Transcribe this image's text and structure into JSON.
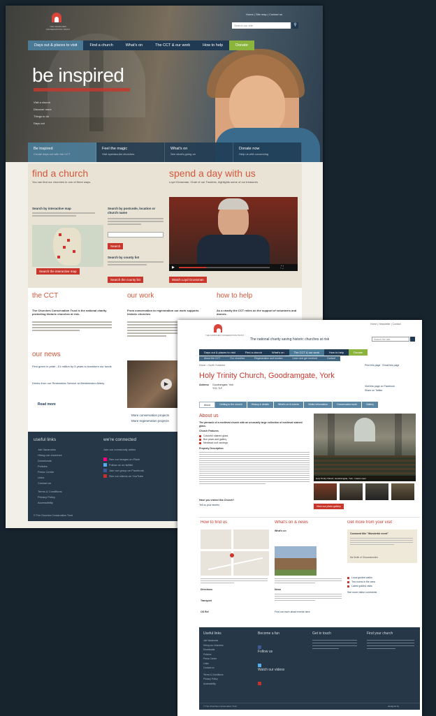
{
  "screen1": {
    "logo_text": "THE CHURCHES\nCONSERVATION TRUST",
    "top_links": [
      "Home",
      "Site map",
      "Contact us"
    ],
    "search_placeholder": "Search our site",
    "nav": [
      "Days out & places to visit",
      "Find a church",
      "What's on",
      "The CCT & our work",
      "How to help",
      "Donate"
    ],
    "hero_title": "be inspired",
    "hero_bullets": [
      "Visit a church",
      "Discover more",
      "Things to do",
      "Days out"
    ],
    "hero_tabs": [
      {
        "title": "Be inspired",
        "sub": "Create days out with the CCT"
      },
      {
        "title": "Feel the magic",
        "sub": "Visit spectacular churches"
      },
      {
        "title": "What's on",
        "sub": "See what's going on"
      },
      {
        "title": "Donate now",
        "sub": "Help us with conserving"
      }
    ],
    "find_church": {
      "title": "find a church",
      "intro": "You can find our churches in one of three ways.",
      "map_title": "Search by interactive map",
      "postcode_title": "Search by postcode, location or church name",
      "search_button": "Search",
      "county_title": "Search by county list",
      "map_button": "Search the interactive map",
      "county_button": "Search the county list"
    },
    "spend_day": {
      "title": "spend a day with us",
      "intro": "Loyd Grossman, Chair of our Trustees, highlights some of our treasures",
      "video_button": "Watch Loyd Grossman"
    },
    "cct": {
      "title": "the CCT",
      "lead": "The Churches Conservation Trust is the national charity protecting historic churches at risk."
    },
    "our_work": {
      "title": "our work",
      "lead": "From conservation to regeneration our work supports historic churches"
    },
    "how_help": {
      "title": "how to help",
      "lead": "As a charity the CCT relies on the support of volunteers and donors."
    },
    "news": {
      "title": "our news",
      "items": [
        "First green in pride - £1 million by 5 years to transform our fonds",
        "Drinks from our Restoration Service at Westminster Abbey"
      ],
      "read_more": "Read more"
    },
    "work_links": [
      "More conservation projects",
      "More regeneration projects"
    ],
    "footer": {
      "useful_links_title": "useful links",
      "useful_links": [
        "Job Vacancies",
        "Hiring our churches",
        "Downloads",
        "Policies",
        "Press Centre",
        "Links",
        "Contact us",
        "",
        "Terms & Conditions",
        "Privacy Policy",
        "Accessibility"
      ],
      "connected_title": "we're connected",
      "connected_intro": "Join our community online",
      "connected_items": [
        "See our images on Flickr",
        "Follow us on twitter",
        "Join our group on Facebook",
        "See our videos on YouTube"
      ],
      "copyright": "© The Churches Conservation Trust"
    }
  },
  "screen2": {
    "tagline": "The national charity saving historic churches at risk",
    "top_links": "Home | Newsletter | Contact",
    "search_placeholder": "Search the site",
    "nav": [
      "Days out & places to visit",
      "Find a church",
      "What's on",
      "The CCT & our work",
      "How to help",
      "Donate"
    ],
    "subnav": [
      "About the CCT",
      "Our churches",
      "Regeneration and tourism",
      "Learn and get involved",
      "Contact"
    ],
    "breadcrumb": "Home > North Yorkshire",
    "page_title": "Holy Trinity Church, Goodramgate, York",
    "address_label": "Address",
    "address_lines": [
      "Goodramgate, York",
      "YO1 7LF"
    ],
    "print_links": [
      "Print this page",
      "Email this page"
    ],
    "side_links": [
      "Visit this page on Facebook",
      "Share on Twitter"
    ],
    "tabs": [
      "About",
      "Getting to the church",
      "History & details",
      "What's on & events",
      "Visitor information",
      "Conservation work",
      "Gallery"
    ],
    "about": {
      "title": "About us",
      "lead": "The pinnacle of a medieval church with an unusually large collection of medieval stained glass.",
      "feature_title": "Church Features",
      "features": [
        "Colourful stained glass",
        "Box pews and gallery",
        "Medieval roof carvings"
      ],
      "desc_title": "Property Description",
      "visited_title": "Have you visited this Church?",
      "visited_link": "Tell us your stories",
      "photo_caption": "Holy Trinity Church, Goodramgate, York - interior view",
      "gallery_button": "View our photo gallery"
    },
    "find_us": {
      "title": "How to find us",
      "directions_title": "Directions",
      "transport_title": "Transport",
      "ref_title": "OS Ref"
    },
    "whats_on": {
      "title": "What's on & news",
      "item_title": "What's on",
      "news_title": "News",
      "more": "Find out more about events here"
    },
    "get_more": {
      "title": "Get more from your visit",
      "box_title": "Comment title \"Wonderful event\"",
      "box_sub": "Ms Smith of Gloucestershire",
      "links": [
        "Local guided walks",
        "Tea rooms in the area",
        "Latest guided visits"
      ],
      "all_link": "See more visitor comments"
    },
    "footer": {
      "useful_title": "Useful links",
      "useful_links": [
        "Job Vacancies",
        "Hiring our churches",
        "Downloads",
        "Policies",
        "Press Centre",
        "Links",
        "Contact us",
        "",
        "Terms & Conditions",
        "Privacy Policy",
        "Accessibility"
      ],
      "become_title": "Become a fan",
      "follow_title": "Follow us",
      "watch_title": "Watch our videos",
      "contact_title": "Get in touch",
      "find_title": "Find your church",
      "copyright": "© The Churches Conservation Trust",
      "designed": "designed by"
    }
  },
  "colors": {
    "navy": "#1f3a52",
    "accent_blue": "#4b7a96",
    "red": "#c9372c",
    "orange_heading": "#d4573b",
    "donate_green": "#8ab43c",
    "footer": "#263847",
    "background": "#17242e"
  }
}
